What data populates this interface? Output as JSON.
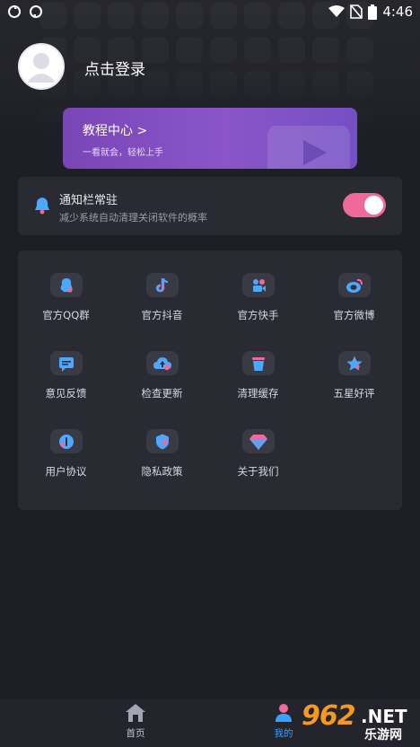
{
  "status_bar": {
    "time": "4:46"
  },
  "profile": {
    "login_label": "点击登录"
  },
  "tutorial": {
    "title": "教程中心 >",
    "subtitle": "一看就会，轻松上手"
  },
  "notification": {
    "title": "通知栏常驻",
    "subtitle": "减少系统自动清理关闭软件的概率",
    "toggle_on": true
  },
  "menu": {
    "items": [
      {
        "label": "官方QQ群",
        "icon": "qq-icon"
      },
      {
        "label": "官方抖音",
        "icon": "douyin-icon"
      },
      {
        "label": "官方快手",
        "icon": "kuaishou-icon"
      },
      {
        "label": "官方微博",
        "icon": "weibo-icon"
      },
      {
        "label": "意见反馈",
        "icon": "feedback-icon"
      },
      {
        "label": "检查更新",
        "icon": "update-icon"
      },
      {
        "label": "清理缓存",
        "icon": "trash-icon"
      },
      {
        "label": "五星好评",
        "icon": "star-icon"
      },
      {
        "label": "用户协议",
        "icon": "agreement-icon"
      },
      {
        "label": "隐私政策",
        "icon": "shield-icon"
      },
      {
        "label": "关于我们",
        "icon": "diamond-icon"
      }
    ]
  },
  "bottom_nav": {
    "home_label": "首页",
    "mine_label": "我的"
  },
  "watermark": {
    "number": "962",
    "suffix": ".NET",
    "text": "乐游网"
  },
  "colors": {
    "background": "#1e1e26",
    "card": "#2a2a33",
    "accent_pink": "#ef6a9b",
    "accent_purple": "#8a55c8",
    "active_nav": "#3aa0ff"
  }
}
